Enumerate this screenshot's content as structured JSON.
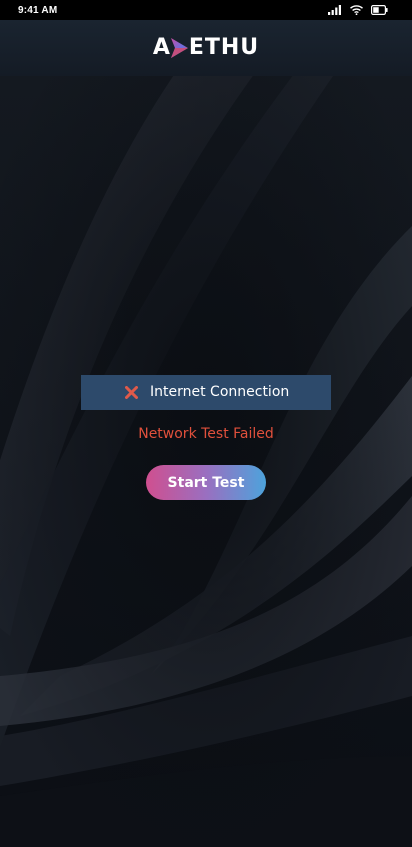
{
  "status_bar": {
    "time": "9:41 AM",
    "icons": [
      "signal-icon",
      "wifi-icon",
      "battery-icon"
    ]
  },
  "header": {
    "logo_text_start": "A",
    "logo_text_end": "ETHU",
    "logo_mark_colors": [
      "#c94da3",
      "#6b6fe0",
      "#d14a6d"
    ]
  },
  "network_check": {
    "status_icon": "close-icon",
    "label": "Internet Connection",
    "result": "Network Test Failed",
    "start_label": "Start Test"
  },
  "colors": {
    "card_background": "#2d4a6b",
    "error_text": "#e0503c",
    "icon_error": "#e05a4a",
    "button_gradient_start": "#d04f8f",
    "button_gradient_end": "#4da3dc",
    "background": "#0f131a"
  }
}
